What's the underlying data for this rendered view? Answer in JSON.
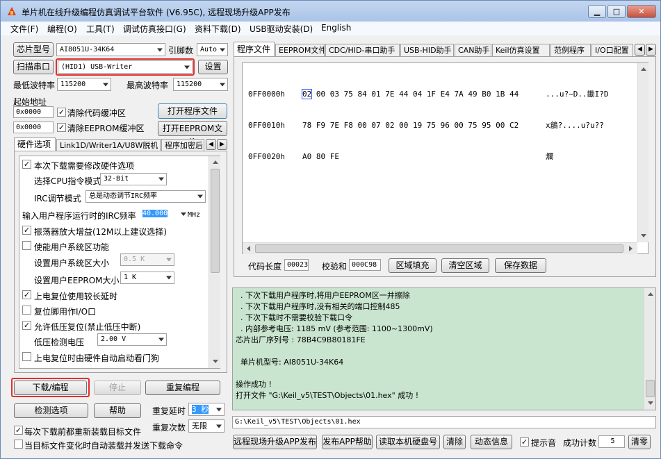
{
  "window": {
    "title": "单片机在线升级编程仿真调试平台软件 (V6.95C), 远程现场升级APP发布"
  },
  "menu": [
    "文件(F)",
    "编程(O)",
    "工具(T)",
    "调试仿真接口(G)",
    "资料下载(D)",
    "USB驱动安装(D)",
    "English"
  ],
  "left": {
    "chip_btn": "芯片型号",
    "chip_value": "AI8051U-34K64",
    "pin_label": "引脚数",
    "pin_value": "Auto",
    "scan_btn": "扫描串口",
    "port_value": "(HID1) USB-Writer",
    "setup_btn": "设置",
    "min_baud_label": "最低波特率",
    "min_baud": "115200",
    "max_baud_label": "最高波特率",
    "max_baud": "115200",
    "start_addr_label": "起始地址",
    "addr1": "0x0000",
    "clear_code": "清除代码缓冲区",
    "open_prog": "打开程序文件",
    "addr2": "0x0000",
    "clear_eeprom": "清除EEPROM缓冲区",
    "open_eeprom": "打开EEPROM文件"
  },
  "hw_tabs": [
    "硬件选项",
    "Link1D/Writer1A/U8W脱机",
    "程序加密后"
  ],
  "hw": {
    "need_modify": "本次下载需要修改硬件选项",
    "cpu_label": "选择CPU指令模式",
    "cpu_value": "32-Bit",
    "irc_label": "IRC调节模式",
    "irc_value": "总是动态调节IRC频率",
    "freq_label": "输入用户程序运行时的IRC频率",
    "freq_value": "40.000",
    "freq_unit": "MHz",
    "osc_gain": "振荡器放大增益(12M以上建议选择)",
    "user_sys": "使能用户系统区功能",
    "sys_size_label": "设置用户系统区大小",
    "sys_size": "0.5 K",
    "eeprom_size_label": "设置用户EEPROM大小",
    "eeprom_size": "1  K",
    "long_delay": "上电复位使用较长延时",
    "reset_io": "复位脚用作I/O口",
    "lvr": "允许低压复位(禁止低压中断)",
    "lv_label": "低压检测电压",
    "lv_value": "2.00 V",
    "wdt": "上电复位时由硬件自动启动看门狗"
  },
  "actions": {
    "download": "下载/编程",
    "stop": "停止",
    "repeat": "重复编程",
    "check": "检测选项",
    "help": "帮助",
    "repeat_delay_label": "重复延时",
    "repeat_delay": "3 秒",
    "repeat_count_label": "重复次数",
    "repeat_count": "无限",
    "reload": "每次下载前都重新装载目标文件",
    "auto_send": "当目标文件变化时自动装载并发送下载命令"
  },
  "right_tabs": [
    "程序文件",
    "EEPROM文件",
    "CDC/HID-串口助手",
    "USB-HID助手",
    "CAN助手",
    "Keil仿真设置",
    "范例程序",
    "I/O口配置"
  ],
  "hex": [
    {
      "addr": "0FF0000h",
      "bytes": "02 00 03 75 84 01 7E 44 04 1F E4 7A 49 B0 1B 44",
      "ascii": "...u?~D..鋤I?D"
    },
    {
      "addr": "0FF0010h",
      "bytes": "78 F9 7E F8 00 07 02 00 19 75 96 00 75 95 00 C2",
      "ascii": "x鶬?....u?u??"
    },
    {
      "addr": "0FF0020h",
      "bytes": "A0 80 FE",
      "ascii": "爛"
    }
  ],
  "hex_bar": {
    "len_label": "代码长度",
    "len_value": "00023",
    "cksum_label": "校验和",
    "cksum_value": "000C98",
    "fill_btn": "区域填充",
    "clear_btn": "清空区域",
    "save_btn": "保存数据"
  },
  "log": [
    "  . 下次下载用户程序时,将用户EEPROM区一并擦除",
    "  . 下次下载用户程序时,没有相关的端口控制485",
    "  . 下次下载时不需要校验下载口令",
    "  . 内部参考电压: 1185 mV (参考范围: 1100~1300mV)",
    "芯片出厂序列号 : 78B4C9B80181FE",
    "",
    "  单片机型号: AI8051U-34K64",
    "",
    "操作成功 !",
    "打开文件 \"G:\\Keil_v5\\TEST\\Objects\\01.hex\" 成功 !"
  ],
  "path": "G:\\Keil_v5\\TEST\\Objects\\01.hex",
  "bottom": {
    "remote_btn": "远程现场升级APP发布",
    "app_help": "发布APP帮助",
    "read_disk": "读取本机硬盘号",
    "clear": "清除",
    "anim": "动态信息",
    "sound": "提示音",
    "count_label": "成功计数",
    "count_value": "5",
    "reset_count": "清零"
  },
  "colors": {
    "log_bg": "#c9e4cf",
    "highlight": "#e03030",
    "selection": "#3399ff"
  }
}
